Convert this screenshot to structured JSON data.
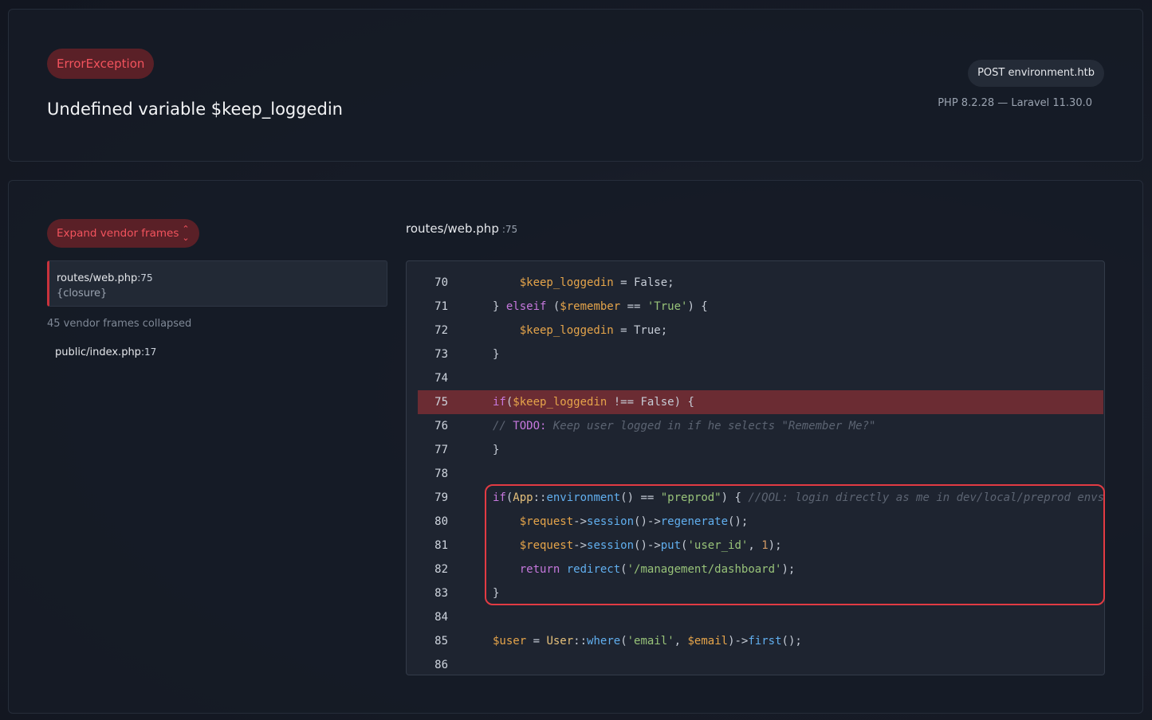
{
  "header": {
    "exception_type": "ErrorException",
    "message": "Undefined variable $keep_loggedin",
    "request": "POST environment.htb",
    "versions": "PHP 8.2.28 — Laravel 11.30.0"
  },
  "sidebar": {
    "expand_button": "Expand vendor frames",
    "active_frame": {
      "file": "routes/web.php",
      "line": ":75",
      "function": "{closure}"
    },
    "collapsed_label": "45 vendor frames collapsed",
    "other_frame": {
      "file": "public/index.php",
      "line": ":17"
    }
  },
  "code_panel": {
    "file": "routes/web.php",
    "line": ":75",
    "highlight_line": 75,
    "lines": [
      {
        "num": "70",
        "tokens": [
          [
            "v",
            "    $keep_loggedin"
          ],
          [
            "p",
            " = False;"
          ]
        ]
      },
      {
        "num": "71",
        "tokens": [
          [
            "p",
            "} "
          ],
          [
            "k",
            "elseif"
          ],
          [
            "p",
            " ("
          ],
          [
            "v",
            "$remember"
          ],
          [
            "p",
            " == "
          ],
          [
            "s",
            "'True'"
          ],
          [
            "p",
            ") {"
          ]
        ]
      },
      {
        "num": "72",
        "tokens": [
          [
            "v",
            "    $keep_loggedin"
          ],
          [
            "p",
            " = True;"
          ]
        ]
      },
      {
        "num": "73",
        "tokens": [
          [
            "p",
            "}"
          ]
        ]
      },
      {
        "num": "74",
        "tokens": []
      },
      {
        "num": "75",
        "tokens": [
          [
            "k",
            "if"
          ],
          [
            "p",
            "("
          ],
          [
            "v",
            "$keep_loggedin"
          ],
          [
            "p",
            " !== False) {"
          ]
        ]
      },
      {
        "num": "76",
        "tokens": [
          [
            "c",
            "// "
          ],
          [
            "k",
            "TODO:"
          ],
          [
            "c",
            " Keep user logged in if he selects \"Remember Me?\""
          ]
        ]
      },
      {
        "num": "77",
        "tokens": [
          [
            "p",
            "}"
          ]
        ]
      },
      {
        "num": "78",
        "tokens": []
      },
      {
        "num": "79",
        "tokens": [
          [
            "k",
            "if"
          ],
          [
            "p",
            "("
          ],
          [
            "cl",
            "App"
          ],
          [
            "p",
            "::"
          ],
          [
            "f",
            "environment"
          ],
          [
            "p",
            "() == "
          ],
          [
            "s",
            "\"preprod\""
          ],
          [
            "p",
            ") { "
          ],
          [
            "c",
            "//QOL: login directly as me in dev/local/preprod envs"
          ]
        ]
      },
      {
        "num": "80",
        "tokens": [
          [
            "v",
            "    $request"
          ],
          [
            "p",
            "->"
          ],
          [
            "f",
            "session"
          ],
          [
            "p",
            "()->"
          ],
          [
            "f",
            "regenerate"
          ],
          [
            "p",
            "();"
          ]
        ]
      },
      {
        "num": "81",
        "tokens": [
          [
            "v",
            "    $request"
          ],
          [
            "p",
            "->"
          ],
          [
            "f",
            "session"
          ],
          [
            "p",
            "()->"
          ],
          [
            "f",
            "put"
          ],
          [
            "p",
            "("
          ],
          [
            "s",
            "'user_id'"
          ],
          [
            "p",
            ", "
          ],
          [
            "n",
            "1"
          ],
          [
            "p",
            ");"
          ]
        ]
      },
      {
        "num": "82",
        "tokens": [
          [
            "k",
            "    return"
          ],
          [
            "p",
            " "
          ],
          [
            "f",
            "redirect"
          ],
          [
            "p",
            "("
          ],
          [
            "s",
            "'/management/dashboard'"
          ],
          [
            "p",
            ");"
          ]
        ]
      },
      {
        "num": "83",
        "tokens": [
          [
            "p",
            "}"
          ]
        ]
      },
      {
        "num": "84",
        "tokens": []
      },
      {
        "num": "85",
        "tokens": [
          [
            "v",
            "$user"
          ],
          [
            "p",
            " = "
          ],
          [
            "cl",
            "User"
          ],
          [
            "p",
            "::"
          ],
          [
            "f",
            "where"
          ],
          [
            "p",
            "("
          ],
          [
            "s",
            "'email'"
          ],
          [
            "p",
            ", "
          ],
          [
            "v",
            "$email"
          ],
          [
            "p",
            ")->"
          ],
          [
            "f",
            "first"
          ],
          [
            "p",
            "();"
          ]
        ]
      },
      {
        "num": "86",
        "tokens": []
      }
    ]
  }
}
